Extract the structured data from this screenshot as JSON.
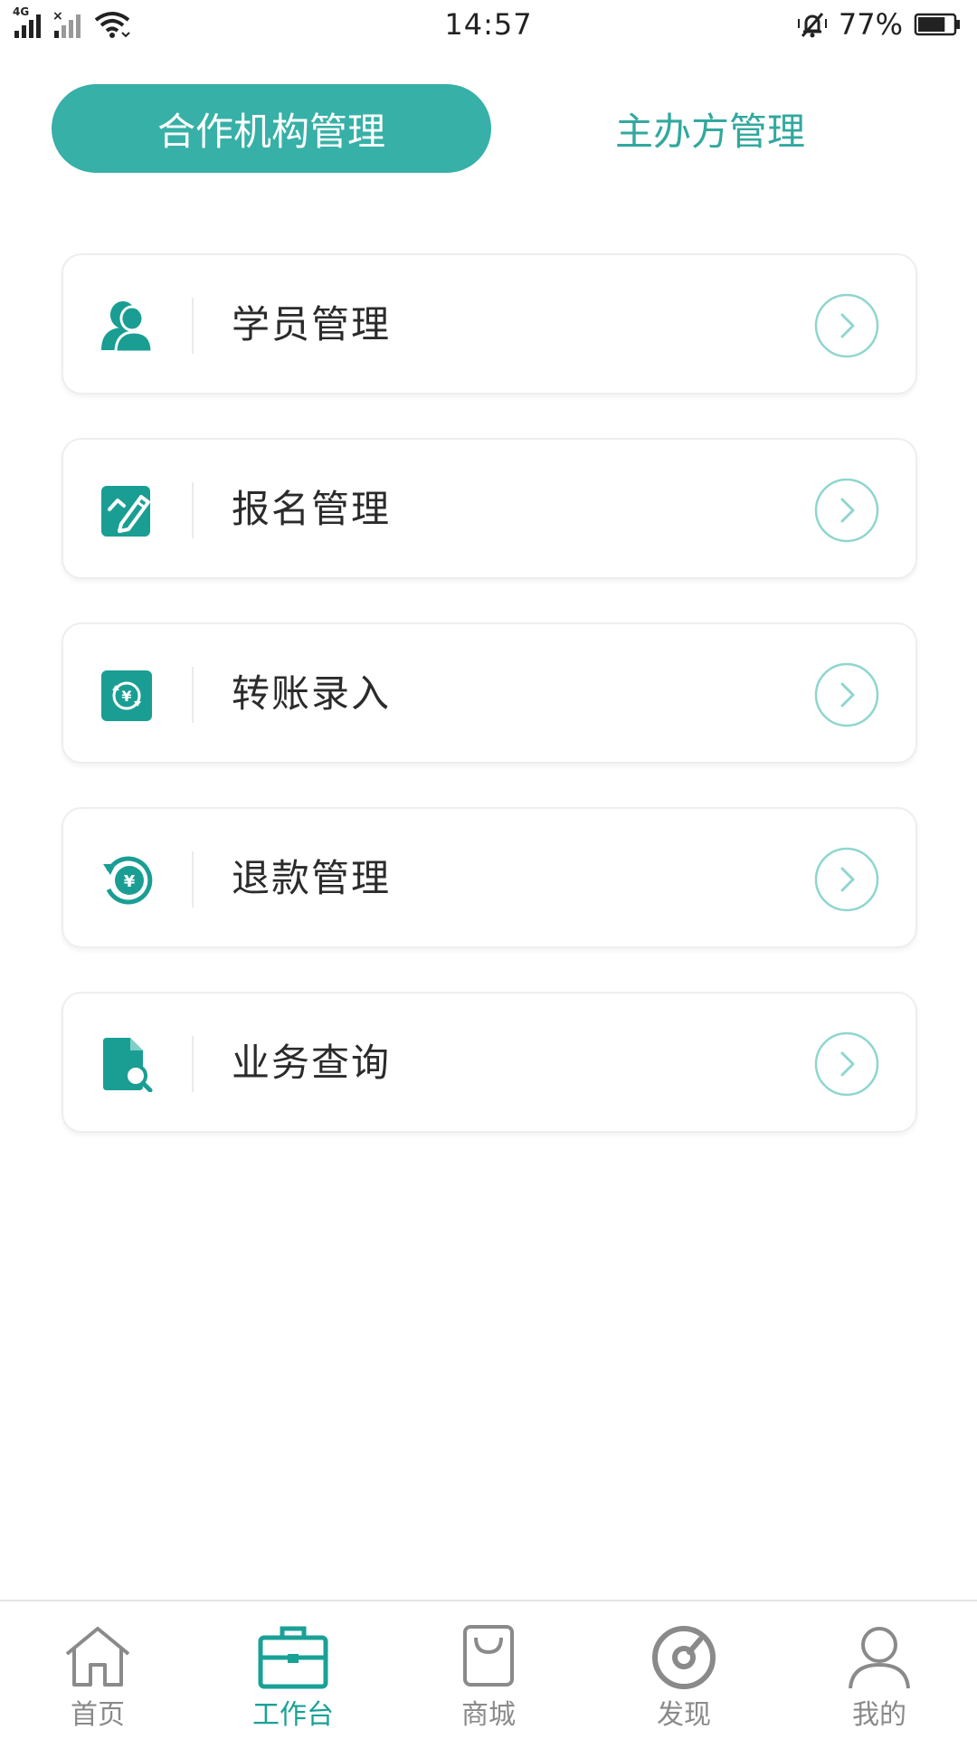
{
  "status_bar": {
    "network_tag": "4G",
    "time": "14:57",
    "battery_text": "77%",
    "battery_level": 0.77,
    "icons": [
      "signal-icon",
      "signal-x-icon",
      "wifi-icon",
      "mute-bell-icon",
      "battery-icon"
    ]
  },
  "tabs": [
    {
      "label": "合作机构管理",
      "active": true
    },
    {
      "label": "主办方管理",
      "active": false
    }
  ],
  "menu": [
    {
      "label": "学员管理",
      "icon": "user-icon"
    },
    {
      "label": "报名管理",
      "icon": "edit-icon"
    },
    {
      "label": "转账录入",
      "icon": "transfer-yuan-icon"
    },
    {
      "label": "退款管理",
      "icon": "refund-yuan-icon"
    },
    {
      "label": "业务查询",
      "icon": "document-search-icon"
    }
  ],
  "bottom_nav": [
    {
      "label": "首页",
      "icon": "home-icon",
      "active": false
    },
    {
      "label": "工作台",
      "icon": "briefcase-icon",
      "active": true
    },
    {
      "label": "商城",
      "icon": "shopping-bag-icon",
      "active": false
    },
    {
      "label": "发现",
      "icon": "compass-icon",
      "active": false
    },
    {
      "label": "我的",
      "icon": "profile-icon",
      "active": false
    }
  ],
  "colors": {
    "accent": "#37b0a7",
    "accent_text": "#33a89e",
    "icon_teal": "#1a9e93",
    "arrow_circle": "#8fd6cf",
    "nav_inactive": "#8a8a8a"
  }
}
